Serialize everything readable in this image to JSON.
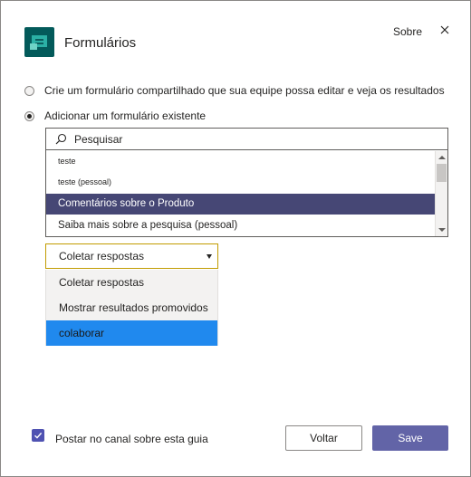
{
  "header": {
    "app_title": "Formulários",
    "about_label": "Sobre",
    "app_icon": "forms-icon",
    "close_icon": "close-icon"
  },
  "options": {
    "create_label": "Crie um formulário compartilhado que sua equipe possa editar e veja os resultados",
    "create_selected": false,
    "existing_label": "Adicionar um formulário existente",
    "existing_selected": true
  },
  "search": {
    "placeholder": "Pesquisar",
    "icon": "search-icon"
  },
  "forms_list": {
    "items": [
      "teste",
      "teste (pessoal)",
      "Comentários sobre o Produto",
      "Saiba mais sobre a pesquisa (pessoal)"
    ],
    "selected_index": 2
  },
  "action_select": {
    "value": "Coletar respostas",
    "options": [
      "Coletar respostas",
      "Mostrar resultados promovidos",
      "colaborar"
    ],
    "highlighted_index": 2
  },
  "footer": {
    "post_label": "Postar no canal sobre esta guia",
    "post_checked": true,
    "back_label": "Voltar",
    "save_label": "Save"
  },
  "colors": {
    "brand": "#6264a7",
    "selected_row": "#464775",
    "menu_highlight": "#2089ee",
    "app_icon_bg": "#035a5a"
  }
}
